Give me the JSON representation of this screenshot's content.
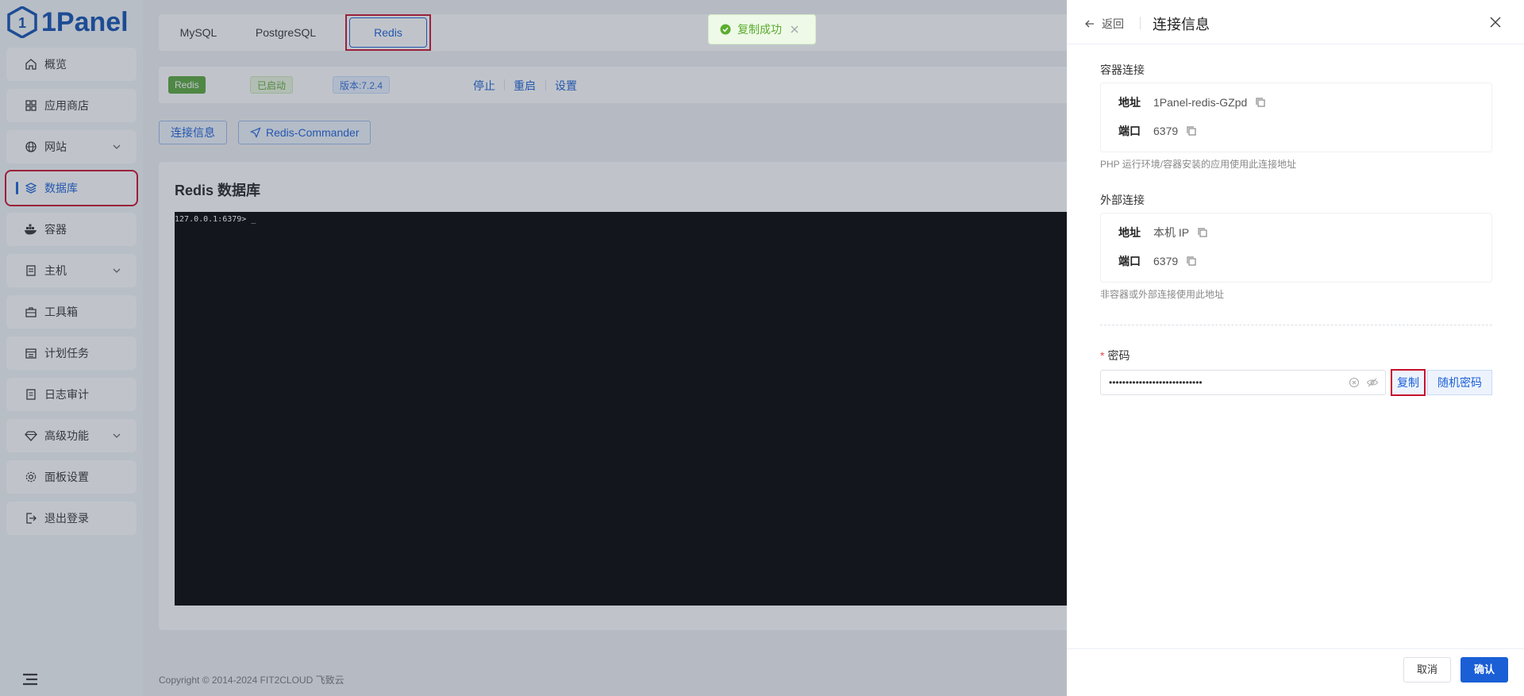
{
  "app": {
    "logo_text": "1Panel",
    "brand_color": "#0f4eb0",
    "accent_color": "#1a5fd6"
  },
  "sidebar": {
    "items": [
      {
        "label": "概览",
        "icon": "home-icon"
      },
      {
        "label": "应用商店",
        "icon": "grid-icon"
      },
      {
        "label": "网站",
        "icon": "globe-icon"
      },
      {
        "label": "数据库",
        "icon": "layers-icon"
      },
      {
        "label": "容器",
        "icon": "docker-icon"
      },
      {
        "label": "主机",
        "icon": "server-icon"
      },
      {
        "label": "工具箱",
        "icon": "toolbox-icon"
      },
      {
        "label": "计划任务",
        "icon": "calendar-icon"
      },
      {
        "label": "日志审计",
        "icon": "log-icon"
      },
      {
        "label": "高级功能",
        "icon": "diamond-icon"
      },
      {
        "label": "面板设置",
        "icon": "gear-icon"
      },
      {
        "label": "退出登录",
        "icon": "logout-icon"
      }
    ],
    "active_label": "数据库"
  },
  "tabs": [
    {
      "label": "MySQL"
    },
    {
      "label": "PostgreSQL"
    },
    {
      "label": "Redis"
    }
  ],
  "status": {
    "name_badge": "Redis",
    "state_badge": "已启动",
    "version_badge": "版本:7.2.4",
    "actions": [
      "停止",
      "重启",
      "设置"
    ]
  },
  "toolbar": {
    "conn_info_label": "连接信息",
    "commander_label": "Redis-Commander"
  },
  "panel": {
    "title": "Redis 数据库",
    "terminal_prompt": "127.0.0.1:6379> _"
  },
  "footer": {
    "copyright": "Copyright © 2014-2024 FIT2CLOUD 飞致云"
  },
  "toast": {
    "message": "复制成功"
  },
  "drawer": {
    "back_label": "返回",
    "title": "连接信息",
    "container": {
      "section_label": "容器连接",
      "address_key": "地址",
      "address_value": "1Panel-redis-GZpd",
      "port_key": "端口",
      "port_value": "6379",
      "hint": "PHP 运行环境/容器安装的应用使用此连接地址"
    },
    "external": {
      "section_label": "外部连接",
      "address_key": "地址",
      "address_value": "本机 IP",
      "port_key": "端口",
      "port_value": "6379",
      "hint": "非容器或外部连接使用此地址"
    },
    "password": {
      "label": "密码",
      "value": "••••••••••••••••••••••••••••",
      "copy_label": "复制",
      "random_label": "随机密码"
    },
    "cancel_label": "取消",
    "confirm_label": "确认"
  }
}
